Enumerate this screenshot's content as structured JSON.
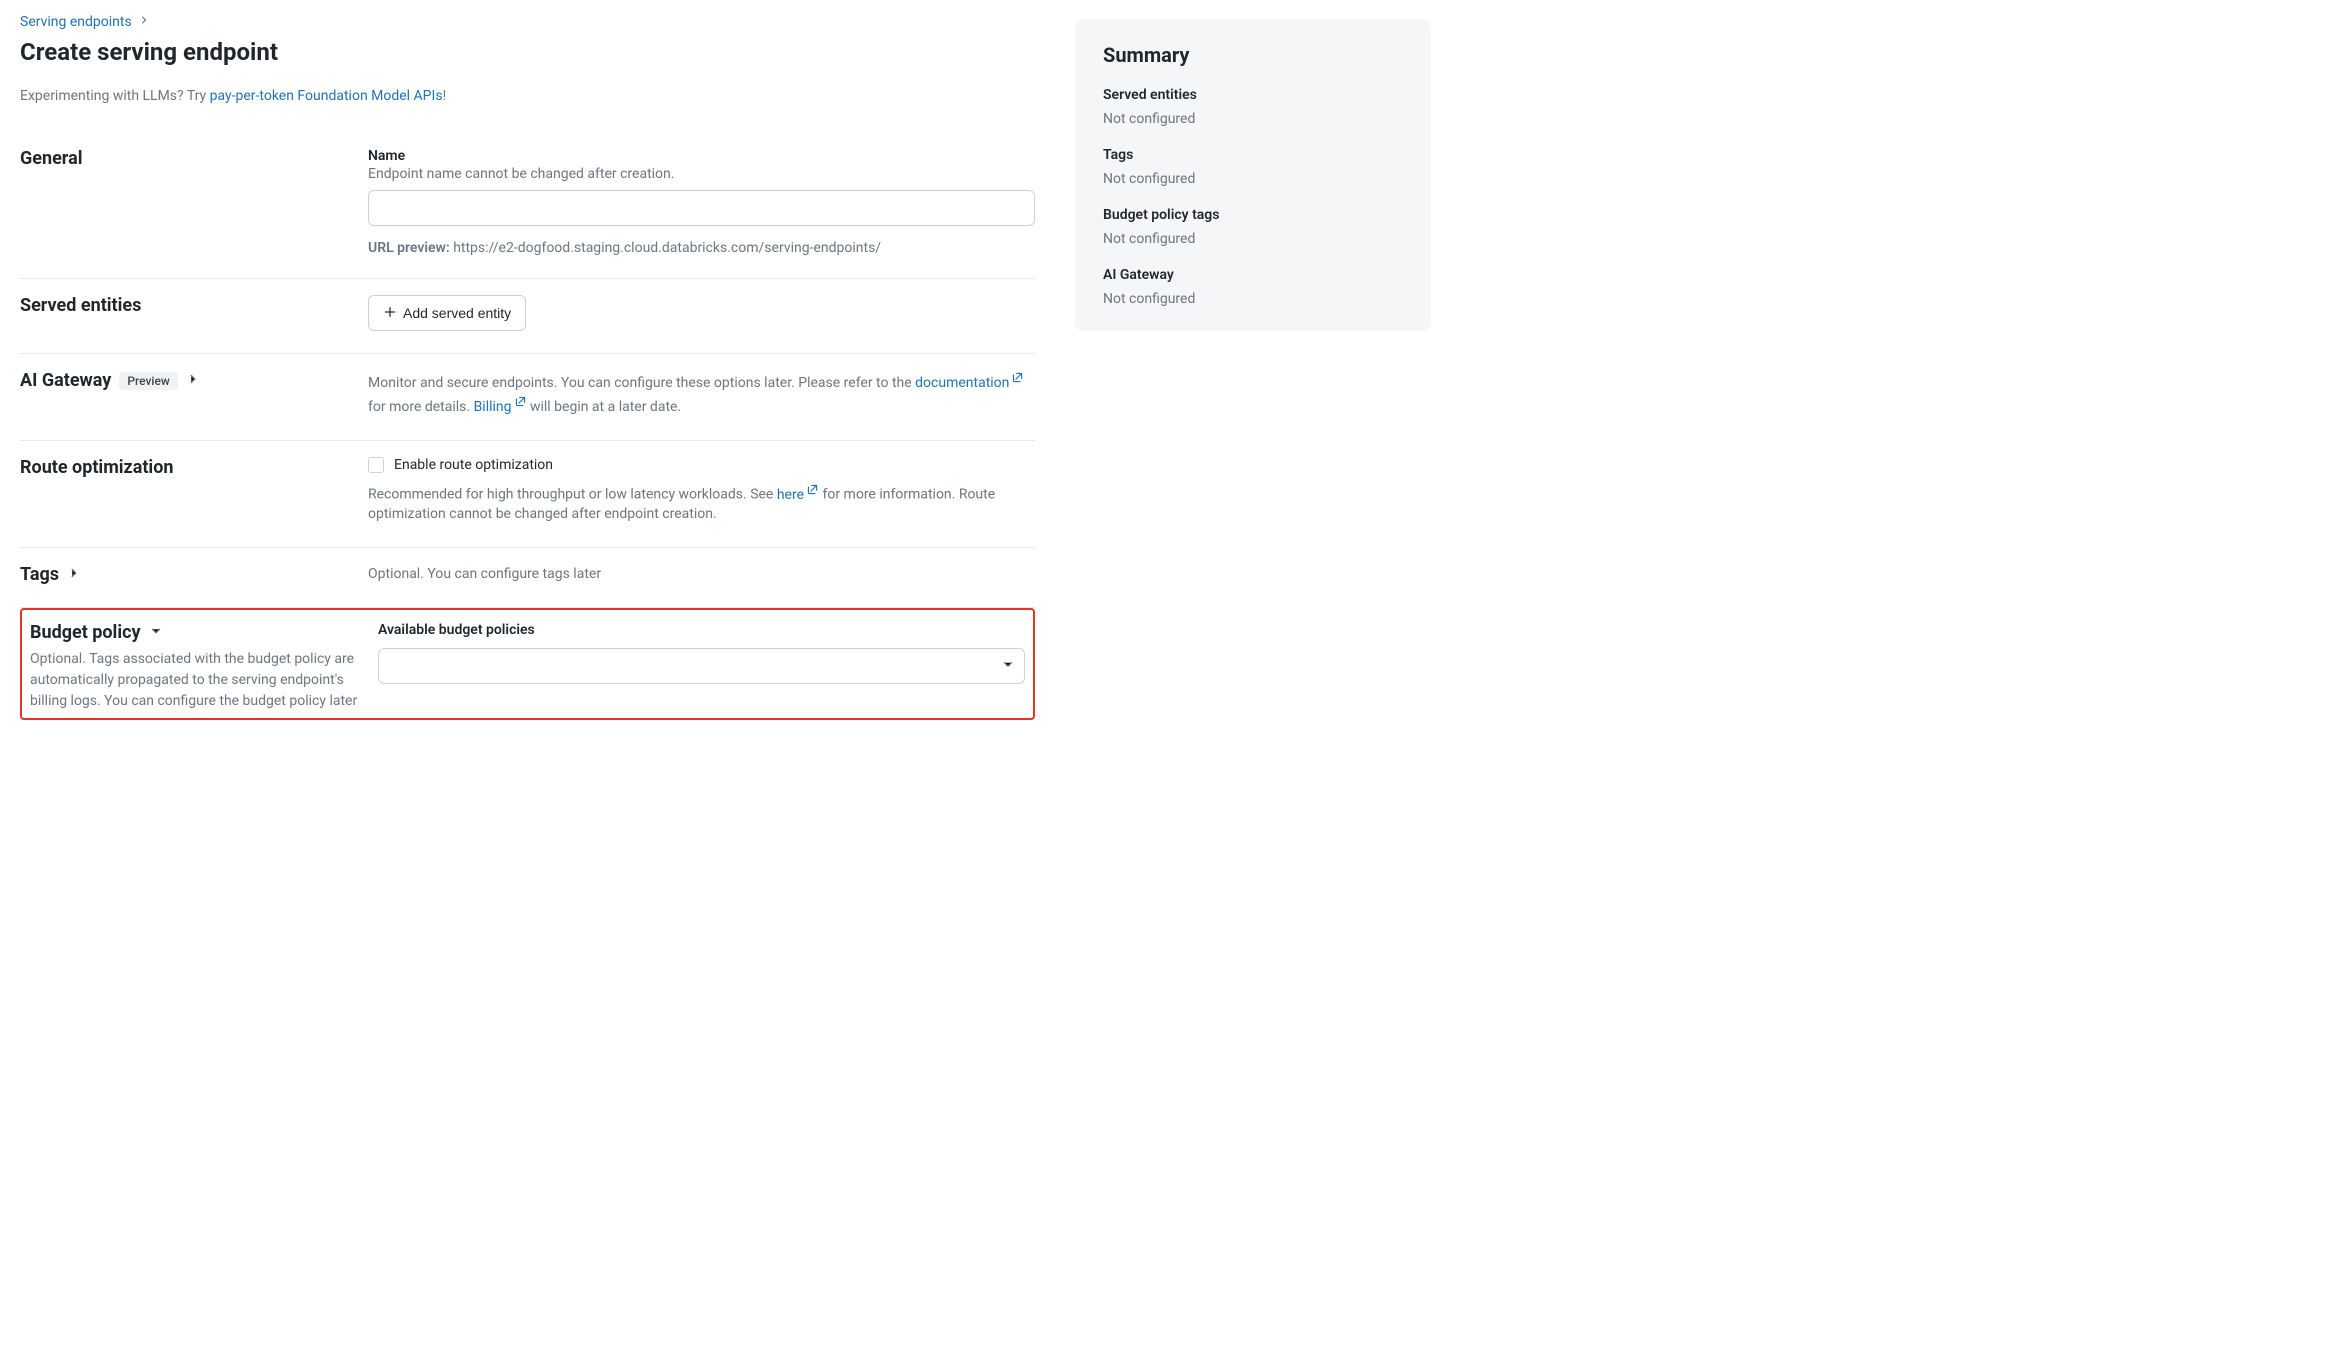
{
  "breadcrumb": {
    "parent": "Serving endpoints"
  },
  "page": {
    "title": "Create serving endpoint",
    "intro_prefix": "Experimenting with LLMs? Try ",
    "intro_link": "pay-per-token Foundation Model APIs",
    "intro_suffix": "!"
  },
  "general": {
    "heading": "General",
    "name_label": "Name",
    "name_help": "Endpoint name cannot be changed after creation.",
    "name_value": "",
    "url_preview_label": "URL preview:",
    "url_preview_value": "https://e2-dogfood.staging.cloud.databricks.com/serving-endpoints/"
  },
  "served_entities": {
    "heading": "Served entities",
    "add_button": "Add served entity"
  },
  "ai_gateway": {
    "heading": "AI Gateway",
    "badge": "Preview",
    "desc_prefix": "Monitor and secure endpoints. You can configure these options later. Please refer to the ",
    "doc_link": "documentation",
    "desc_mid": " for more details. ",
    "billing_link": "Billing",
    "desc_suffix": " will begin at a later date."
  },
  "route_opt": {
    "heading": "Route optimization",
    "checkbox_label": "Enable route optimization",
    "help_prefix": "Recommended for high throughput or low latency workloads. See ",
    "help_link": "here",
    "help_suffix": " for more information. Route optimization cannot be changed after endpoint creation."
  },
  "tags": {
    "heading": "Tags",
    "help": "Optional. You can configure tags later"
  },
  "budget": {
    "heading": "Budget policy",
    "desc": "Optional. Tags associated with the budget policy are automatically propagated to the serving endpoint's billing logs. You can configure the budget policy later",
    "select_label": "Available budget policies",
    "select_value": ""
  },
  "summary": {
    "heading": "Summary",
    "items": [
      {
        "label": "Served entities",
        "value": "Not configured"
      },
      {
        "label": "Tags",
        "value": "Not configured"
      },
      {
        "label": "Budget policy tags",
        "value": "Not configured"
      },
      {
        "label": "AI Gateway",
        "value": "Not configured"
      }
    ]
  }
}
